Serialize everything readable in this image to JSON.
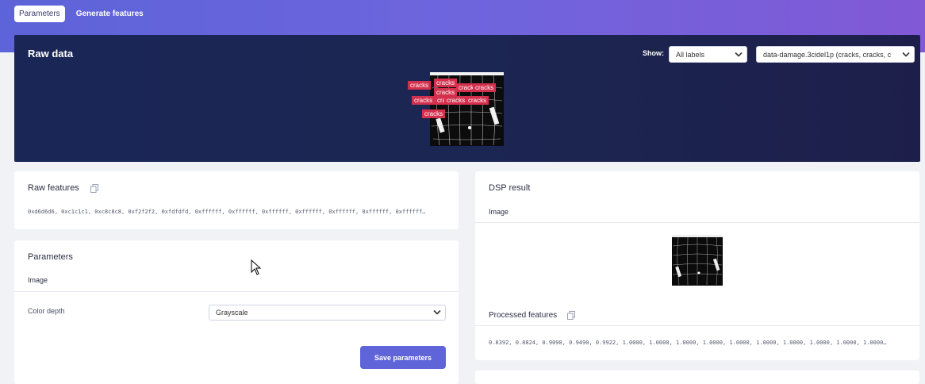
{
  "tabs": [
    {
      "label": "Parameters",
      "active": true
    },
    {
      "label": "Generate features",
      "active": false
    }
  ],
  "raw_data": {
    "title": "Raw data",
    "show_label": "Show:",
    "labels_select": "All labels",
    "sample_select": "data-damage.3cidel1p (cracks, cracks, c",
    "bounding_box_labels": [
      "cracks",
      "cracks",
      "cracks",
      "cracks",
      "cracks",
      "cracks",
      "cracks",
      "cracks",
      "cracks",
      "cracks"
    ]
  },
  "raw_features": {
    "title": "Raw features",
    "values": "0xd6d6d6, 0xc1c1c1, 0xc8c8c8, 0xf2f2f2, 0xfdfdfd, 0xffffff, 0xffffff, 0xffffff, 0xffffff, 0xffffff, 0xffffff, 0xffffff…"
  },
  "parameters": {
    "title": "Parameters",
    "section": "Image",
    "color_depth_label": "Color depth",
    "color_depth_value": "Grayscale",
    "save_label": "Save parameters"
  },
  "dsp_result": {
    "title": "DSP result",
    "section": "Image",
    "processed_title": "Processed features",
    "processed_values": "0.8392, 0.8824, 0.9098, 0.9490, 0.9922, 1.0000, 1.0000, 1.0000, 1.0000, 1.0000, 1.0000, 1.0000, 1.0000, 1.0000, 1.0000…"
  },
  "colors": {
    "accent": "#5f64d9",
    "bbox_label": "#d42f4c",
    "raw_data_bg": "#1c2652"
  }
}
